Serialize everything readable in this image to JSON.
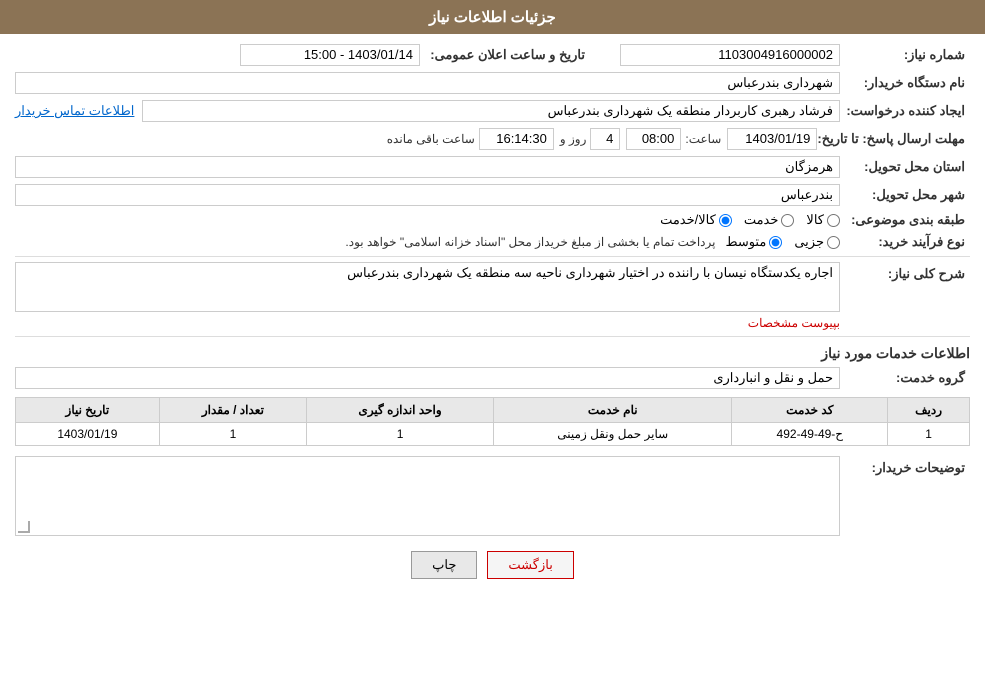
{
  "header": {
    "title": "جزئیات اطلاعات نیاز"
  },
  "fields": {
    "need_number_label": "شماره نیاز:",
    "need_number_value": "1103004916000002",
    "buyer_org_label": "نام دستگاه خریدار:",
    "buyer_org_value": "شهرداری بندرعباس",
    "public_announcement_label": "تاریخ و ساعت اعلان عمومی:",
    "public_announcement_value": "1403/01/14 - 15:00",
    "requester_label": "ایجاد کننده درخواست:",
    "requester_value": "فرشاد رهبری کاربردار منطقه یک شهرداری بندرعباس",
    "contact_link": "اطلاعات تماس خریدار",
    "response_deadline_label": "مهلت ارسال پاسخ: تا تاریخ:",
    "response_date": "1403/01/19",
    "response_time_label": "ساعت:",
    "response_time": "08:00",
    "response_days_label": "روز و",
    "response_days": "4",
    "response_remaining_label": "ساعت باقی مانده",
    "response_remaining": "16:14:30",
    "province_label": "استان محل تحویل:",
    "province_value": "هرمزگان",
    "city_label": "شهر محل تحویل:",
    "city_value": "بندرعباس",
    "category_label": "طبقه بندی موضوعی:",
    "category_options": [
      "کالا",
      "خدمت",
      "کالا/خدمت"
    ],
    "category_selected": "کالا",
    "purchase_type_label": "نوع فرآیند خرید:",
    "purchase_type_options": [
      "جزیی",
      "متوسط"
    ],
    "purchase_type_note": "پرداخت تمام یا بخشی از مبلغ خریداز محل \"اسناد خزانه اسلامی\" خواهد بود.",
    "description_label": "شرح کلی نیاز:",
    "description_value": "اجاره یکدستگاه نیسان با راننده در اختیار شهرداری ناحیه سه منطقه یک شهرداری بندرعباس",
    "attachment_note": "بپیوست مشخصات",
    "services_section_title": "اطلاعات خدمات مورد نیاز",
    "service_group_label": "گروه خدمت:",
    "service_group_value": "حمل و نقل و انبارداری",
    "table": {
      "headers": [
        "ردیف",
        "کد خدمت",
        "نام خدمت",
        "واحد اندازه گیری",
        "تعداد / مقدار",
        "تاریخ نیاز"
      ],
      "rows": [
        {
          "row": "1",
          "code": "ح-49-49-492",
          "name": "سایر حمل ونقل زمینی",
          "unit": "1",
          "quantity": "1",
          "date": "1403/01/19"
        }
      ]
    },
    "buyer_desc_label": "توضیحات خریدار:",
    "buyer_desc_value": ""
  },
  "buttons": {
    "print": "چاپ",
    "back": "بازگشت"
  }
}
